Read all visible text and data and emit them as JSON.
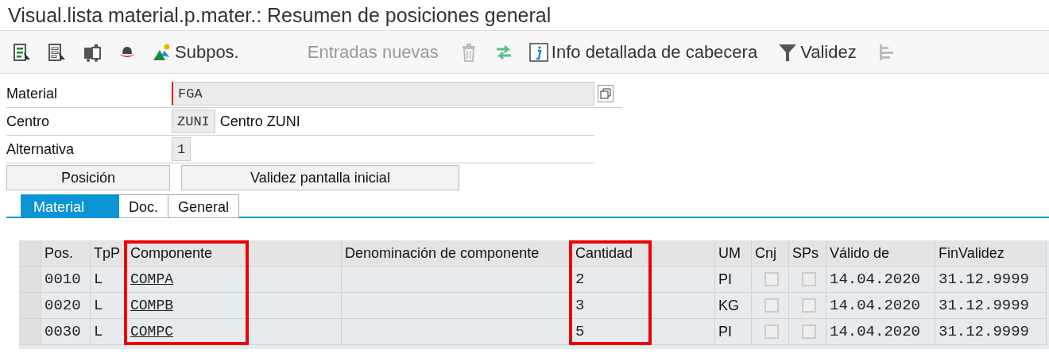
{
  "window": {
    "title": "Visual.lista material.p.mater.: Resumen de posiciones general"
  },
  "toolbar": [
    {
      "kind": "icon",
      "disabled": false
    },
    {
      "kind": "icon",
      "disabled": false
    },
    {
      "kind": "icon",
      "disabled": false
    },
    {
      "kind": "icon",
      "disabled": false
    },
    {
      "kind": "button",
      "label": "Subpos.",
      "disabled": false
    },
    {
      "kind": "button",
      "label": "Entradas nuevas",
      "disabled": true
    },
    {
      "kind": "icon",
      "disabled": true
    },
    {
      "kind": "icon",
      "disabled": false
    },
    {
      "kind": "button",
      "label": "Info detallada de cabecera",
      "disabled": false
    },
    {
      "kind": "button",
      "label": "Validez",
      "disabled": false
    },
    {
      "kind": "icon",
      "disabled": true
    }
  ],
  "header": [
    {
      "kind": "required",
      "label": "Material",
      "value": "FGA"
    },
    {
      "kind": "plain",
      "label": "Centro",
      "value": "ZUNI",
      "description": "Centro ZUNI"
    },
    {
      "kind": "plain",
      "label": "Alternativa",
      "value": "1"
    }
  ],
  "buttons": [
    "Posición",
    "Validez pantalla inicial"
  ],
  "tabs": [
    {
      "label": "Material",
      "selected": true
    },
    {
      "label": "Doc.",
      "selected": false
    },
    {
      "label": "General",
      "selected": false
    }
  ],
  "table": {
    "columns": [
      {
        "label": "Pos.",
        "kind": "mono",
        "highlighted": false
      },
      {
        "label": "TpP",
        "kind": "mono",
        "highlighted": false
      },
      {
        "label": "Componente",
        "kind": "link",
        "highlighted": true
      },
      {
        "label": "Denominación de componente",
        "kind": "mono",
        "highlighted": false
      },
      {
        "label": "Cantidad",
        "kind": "mono",
        "highlighted": true
      },
      {
        "label": "UM",
        "kind": "sans",
        "highlighted": false
      },
      {
        "label": "Cnj",
        "kind": "check",
        "highlighted": false
      },
      {
        "label": "SPs",
        "kind": "check",
        "highlighted": false
      },
      {
        "label": "Válido de",
        "kind": "mono",
        "highlighted": false
      },
      {
        "label": "FinValidez",
        "kind": "mono",
        "highlighted": false
      }
    ],
    "rows": [
      {
        "cells": [
          "0010",
          "L",
          "COMPA",
          "",
          "2",
          "PI",
          false,
          false,
          "14.04.2020",
          "31.12.9999"
        ]
      },
      {
        "cells": [
          "0020",
          "L",
          "COMPB",
          "",
          "3",
          "KG",
          false,
          false,
          "14.04.2020",
          "31.12.9999"
        ]
      },
      {
        "cells": [
          "0030",
          "L",
          "COMPC",
          "",
          "5",
          "PI",
          false,
          false,
          "14.04.2020",
          "31.12.9999"
        ]
      }
    ]
  }
}
